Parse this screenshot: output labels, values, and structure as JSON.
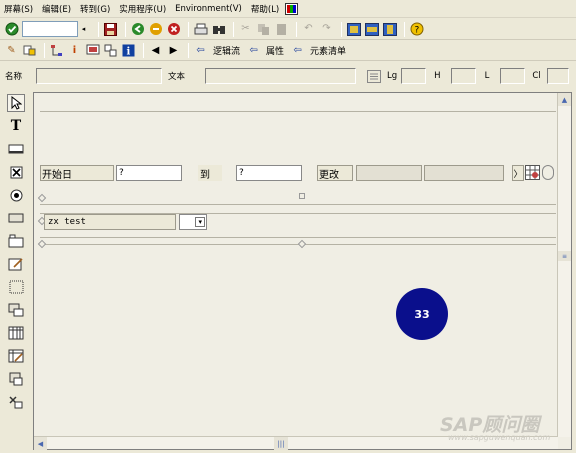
{
  "menu": [
    "屏幕(S)",
    "编辑(E)",
    "转到(G)",
    "实用程序(U)",
    "Environment(V)",
    "帮助(L)"
  ],
  "toolbar2": {
    "logic_label": "逻辑流",
    "attr_label": "属性",
    "elements_label": "元素清单"
  },
  "fields": {
    "name_label": "名称",
    "text_label": "文本",
    "lg_label": "Lg",
    "h_label": "H",
    "l_label": "L",
    "cl_label": "Cl"
  },
  "screen": {
    "start_label": "开始日",
    "start_value": "?",
    "to_label": "到",
    "to_value": "?",
    "change_label": "更改",
    "zx_value": "zx test",
    "circle_value": "33"
  },
  "watermark": {
    "main": "SAP顾问圈",
    "sub": "www.sapguwenquan.com"
  },
  "colors": {
    "circle": "#0a0f8c",
    "background": "#ece9d8"
  }
}
